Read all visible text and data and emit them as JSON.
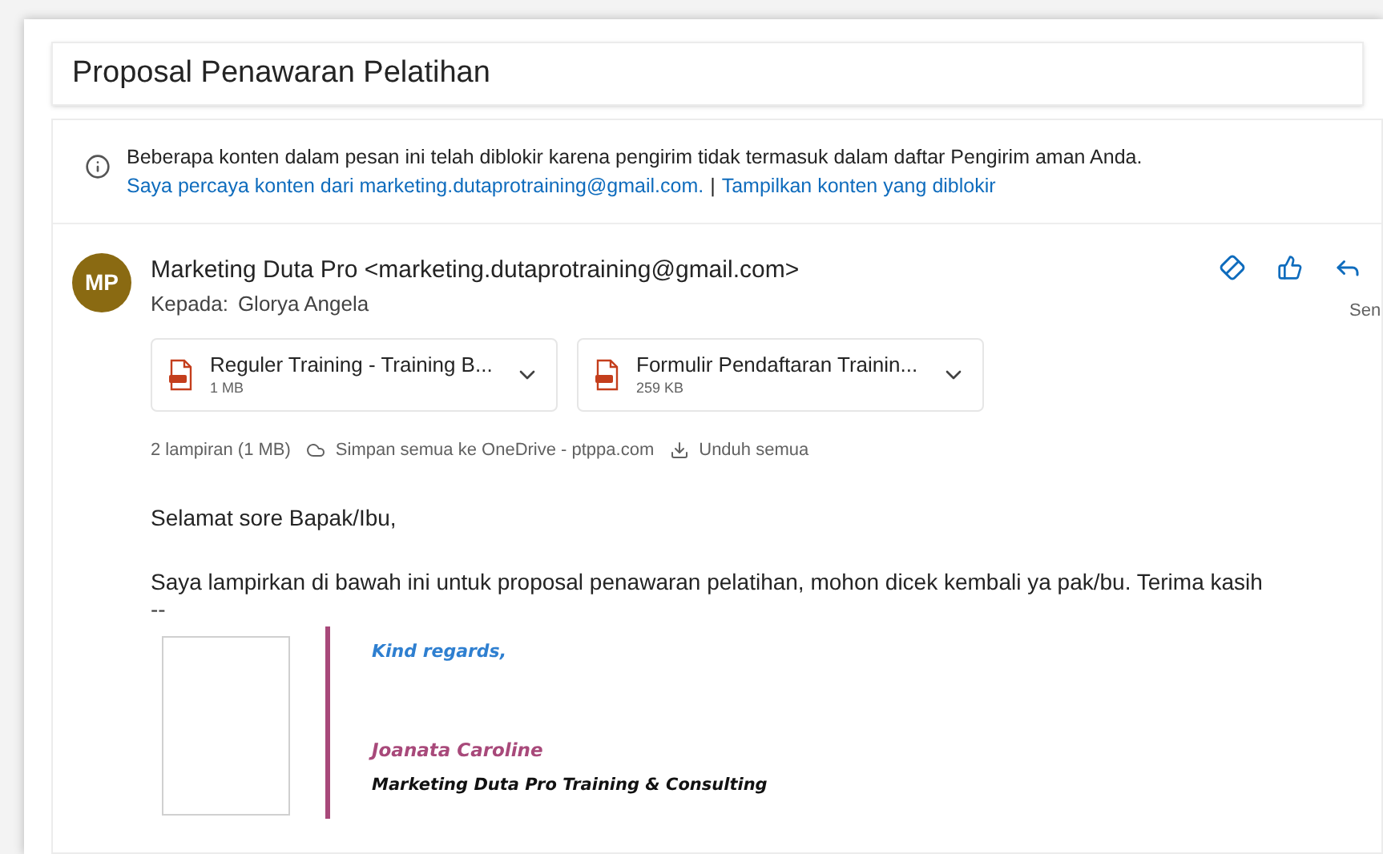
{
  "subject": "Proposal Penawaran Pelatihan",
  "blocked_notice": {
    "message": "Beberapa konten dalam pesan ini telah diblokir karena pengirim tidak termasuk dalam daftar Pengirim aman Anda.",
    "trust_link": "Saya percaya konten dari marketing.dutaprotraining@gmail.com.",
    "separator": "|",
    "show_link": "Tampilkan konten yang diblokir"
  },
  "message": {
    "avatar": "MP",
    "sender": "Marketing Duta Pro <marketing.dutaprotraining@gmail.com>",
    "to_label": "Kepada:",
    "to": "Glorya Angela",
    "date": "Sen",
    "attachments": [
      {
        "name": "Reguler Training - Training B...",
        "size": "1 MB"
      },
      {
        "name": "Formulir Pendaftaran Trainin...",
        "size": "259 KB"
      }
    ],
    "attachment_summary": "2 lampiran (1 MB)",
    "save_all": "Simpan semua ke OneDrive - ptppa.com",
    "download_all": "Unduh semua",
    "body": [
      "Selamat sore Bapak/Ibu,",
      "Saya lampirkan di bawah ini untuk proposal penawaran pelatihan, mohon dicek kembali ya pak/bu. Terima kasih"
    ],
    "sig_separator": "--",
    "signature": {
      "greeting": "Kind regards,",
      "name": "Joanata Caroline",
      "company": "Marketing Duta Pro Training & Consulting"
    }
  }
}
